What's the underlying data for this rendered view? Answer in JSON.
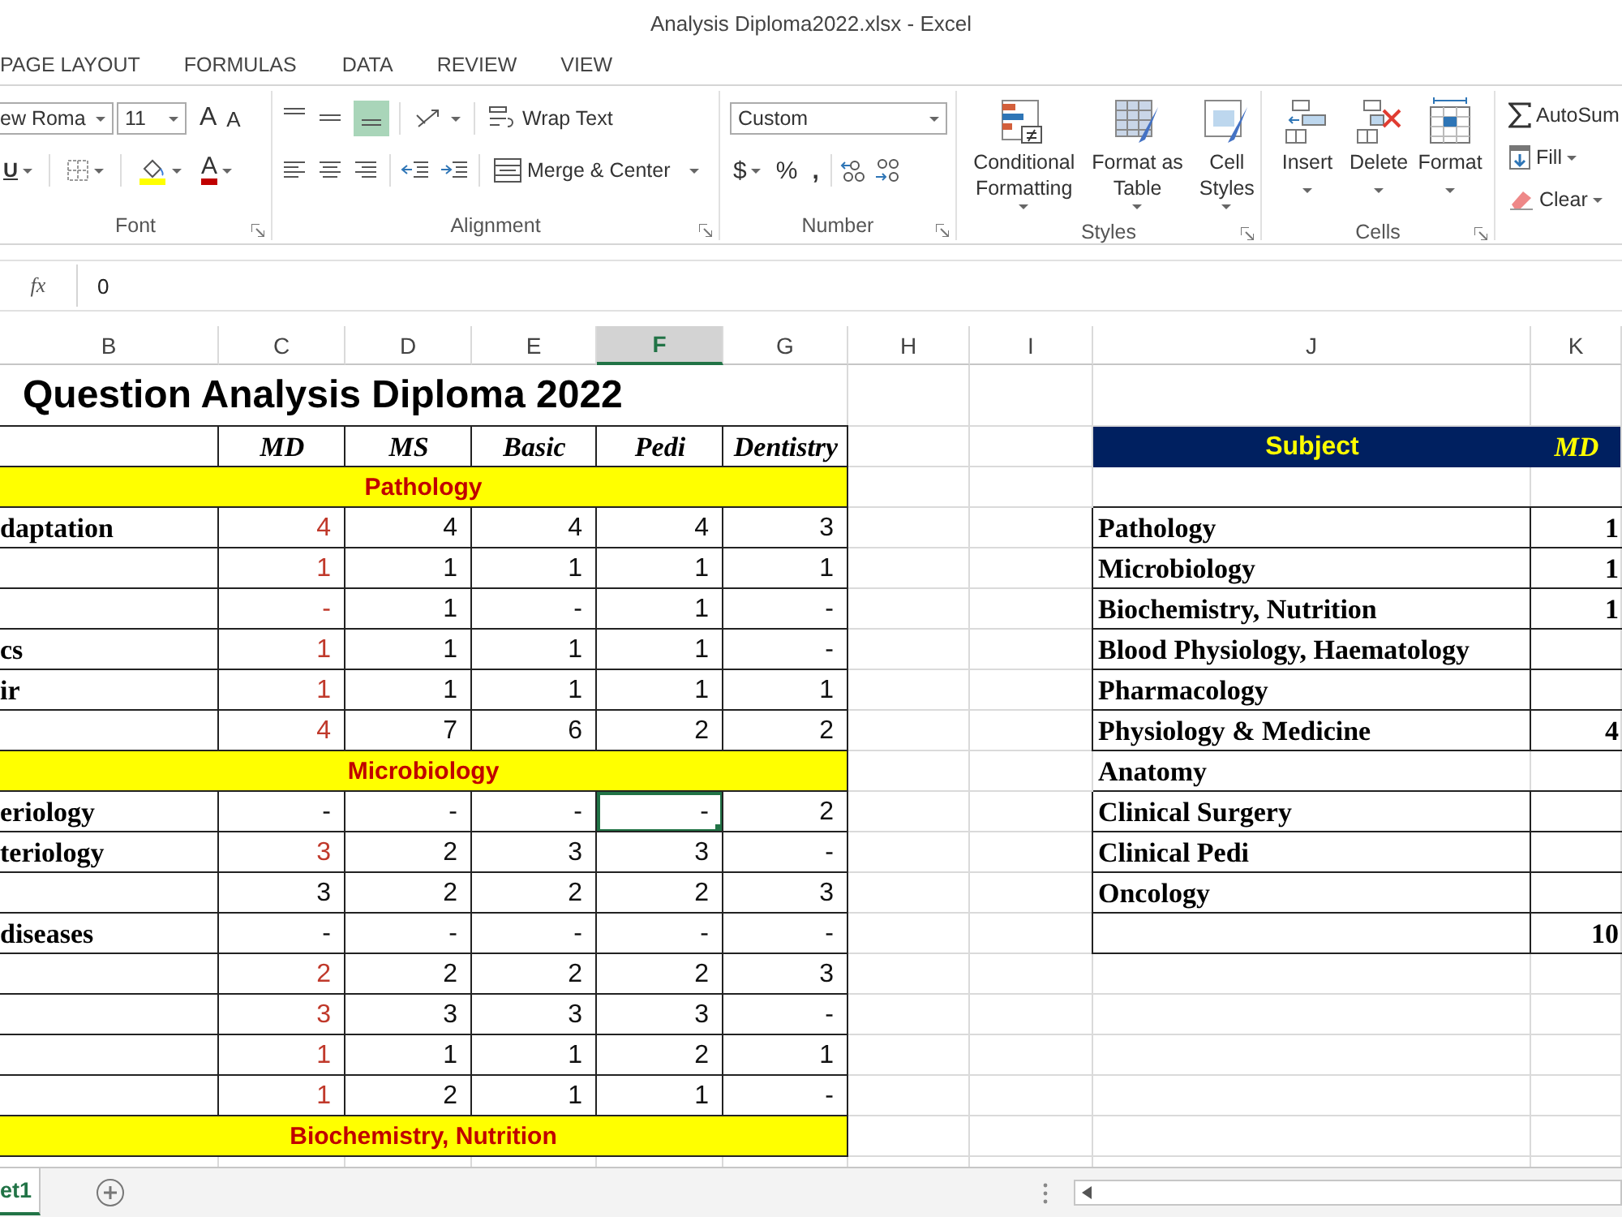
{
  "window": {
    "title": "Analysis Diploma2022.xlsx - Excel"
  },
  "menu_tabs": [
    {
      "label": "PAGE LAYOUT",
      "selected": false
    },
    {
      "label": "FORMULAS",
      "selected": false
    },
    {
      "label": "DATA",
      "selected": false
    },
    {
      "label": "REVIEW",
      "selected": false
    },
    {
      "label": "VIEW",
      "selected": false
    }
  ],
  "ribbon": {
    "font": {
      "font_name": "ew Roma",
      "font_size": "11",
      "grow": "A",
      "shrink": "A",
      "underline": "U",
      "font_color": "A",
      "label": "Font"
    },
    "alignment": {
      "wrap_text": "Wrap Text",
      "merge": "Merge & Center",
      "bottom_align_selected": true,
      "label": "Alignment"
    },
    "number": {
      "format": "Custom",
      "currency": "$",
      "percent": "%",
      "comma": ",",
      "label": "Number"
    },
    "styles": {
      "buttons": [
        "Conditional Formatting",
        "Format as Table",
        "Cell Styles"
      ],
      "label": "Styles"
    },
    "cells": {
      "buttons": [
        "Insert",
        "Delete",
        "Format"
      ],
      "label": "Cells"
    },
    "editing": {
      "autosum": "AutoSum",
      "fill": "Fill",
      "clear": "Clear"
    }
  },
  "formula_bar": {
    "fx": "fx",
    "value": "0"
  },
  "sheet": {
    "columns": [
      {
        "label": "B",
        "selected": false
      },
      {
        "label": "C",
        "selected": false
      },
      {
        "label": "D",
        "selected": false
      },
      {
        "label": "E",
        "selected": false
      },
      {
        "label": "F",
        "selected": true
      },
      {
        "label": "G",
        "selected": false
      },
      {
        "label": "H",
        "selected": false
      },
      {
        "label": "I",
        "selected": false
      },
      {
        "label": "J",
        "selected": false
      },
      {
        "label": "K",
        "selected": false
      }
    ],
    "left_table": {
      "title": "Question Analysis Diploma 2022",
      "headers": [
        "MD",
        "MS",
        "Basic",
        "Pedi",
        "Dentistry"
      ],
      "sections": [
        {
          "name": "Pathology",
          "rows": [
            {
              "label": "daptation",
              "values": [
                "4",
                "4",
                "4",
                "4",
                "3"
              ],
              "md_red": true,
              "selected": false
            },
            {
              "values": [
                "1",
                "1",
                "1",
                "1",
                "1"
              ],
              "md_red": true,
              "selected": false
            },
            {
              "values": [
                "-",
                "1",
                "-",
                "1",
                "-"
              ],
              "md_red": true,
              "selected": false
            },
            {
              "label": "cs",
              "values": [
                "1",
                "1",
                "1",
                "1",
                "-"
              ],
              "md_red": true,
              "selected": false
            },
            {
              "label": "ir",
              "values": [
                "1",
                "1",
                "1",
                "1",
                "1"
              ],
              "md_red": true,
              "selected": false
            },
            {
              "values": [
                "4",
                "7",
                "6",
                "2",
                "2"
              ],
              "md_red": true,
              "selected": false
            }
          ]
        },
        {
          "name": "Microbiology",
          "rows": [
            {
              "label": "eriology",
              "values": [
                "-",
                "-",
                "-",
                "-",
                "2"
              ],
              "md_red": false,
              "selected": true
            },
            {
              "label": "teriology",
              "values": [
                "3",
                "2",
                "3",
                "3",
                "-"
              ],
              "md_red": true,
              "selected": false
            },
            {
              "values": [
                "3",
                "2",
                "2",
                "2",
                "3"
              ],
              "md_red": false,
              "selected": false
            },
            {
              "label": "diseases",
              "values": [
                "-",
                "-",
                "-",
                "-",
                "-"
              ],
              "md_red": false,
              "selected": false
            },
            {
              "values": [
                "2",
                "2",
                "2",
                "2",
                "3"
              ],
              "md_red": true,
              "selected": false
            },
            {
              "values": [
                "3",
                "3",
                "3",
                "3",
                "-"
              ],
              "md_red": true,
              "selected": false
            },
            {
              "values": [
                "1",
                "1",
                "1",
                "2",
                "1"
              ],
              "md_red": true,
              "selected": false
            },
            {
              "values": [
                "1",
                "2",
                "1",
                "1",
                "-"
              ],
              "md_red": true,
              "selected": false
            }
          ]
        },
        {
          "name": "Biochemistry, Nutrition"
        }
      ]
    },
    "right_table": {
      "headers": [
        "Subject",
        "MD"
      ],
      "rows": [
        {
          "subject": "Pathology",
          "md": "1"
        },
        {
          "subject": "Microbiology",
          "md": "1"
        },
        {
          "subject": "Biochemistry, Nutrition",
          "md": "1"
        },
        {
          "subject": "Blood Physiology, Haematology"
        },
        {
          "subject": "Pharmacology"
        },
        {
          "subject": "Physiology & Medicine",
          "md": "4"
        },
        {
          "subject": "Anatomy"
        },
        {
          "subject": "Clinical Surgery"
        },
        {
          "subject": "Clinical Pedi"
        },
        {
          "subject": "Oncology"
        }
      ],
      "total": "10"
    }
  },
  "sheet_tabs": [
    {
      "label": "et1",
      "selected": true
    }
  ]
}
